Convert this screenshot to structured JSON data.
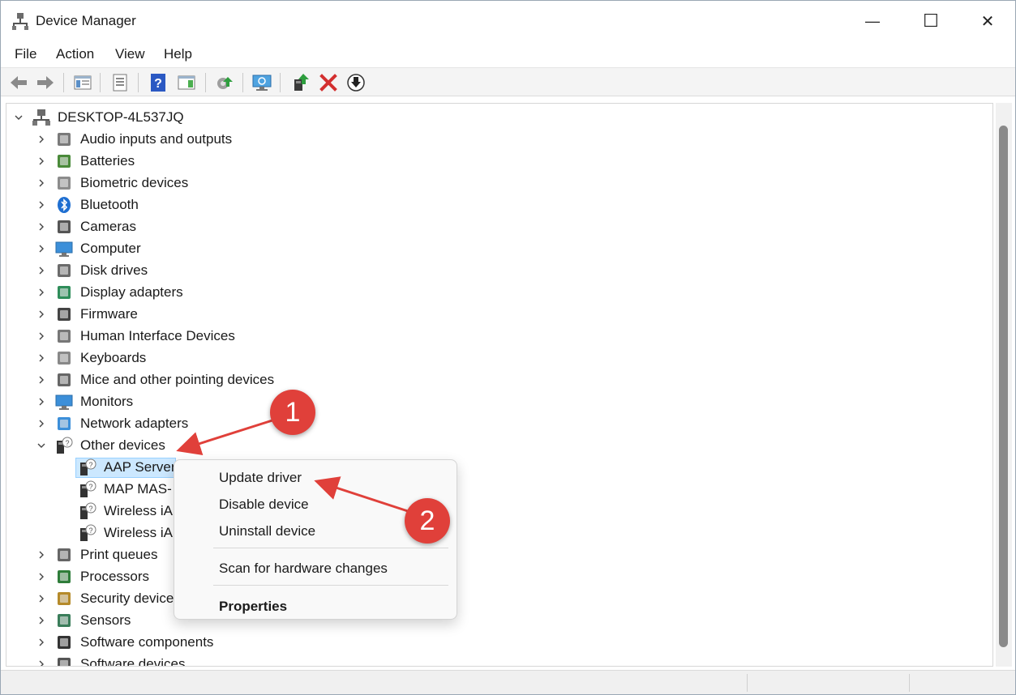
{
  "window": {
    "title": "Device Manager",
    "controls": {
      "minimize": "—",
      "maximize": "☐",
      "close": "✕"
    }
  },
  "menu": [
    "File",
    "Action",
    "View",
    "Help"
  ],
  "toolbar": {
    "icons": [
      "back-icon",
      "forward-icon",
      "show-hide-console-tree-icon",
      "properties-icon",
      "help-icon",
      "action-pane-icon",
      "update-driver-icon",
      "scan-hardware-icon",
      "enable-device-icon",
      "uninstall-device-icon",
      "disable-device-icon"
    ]
  },
  "tree": {
    "root": "DESKTOP-4L537JQ",
    "categories": [
      {
        "label": "Audio inputs and outputs",
        "icon": "speaker-icon"
      },
      {
        "label": "Batteries",
        "icon": "battery-icon"
      },
      {
        "label": "Biometric devices",
        "icon": "fingerprint-icon"
      },
      {
        "label": "Bluetooth",
        "icon": "bluetooth-icon"
      },
      {
        "label": "Cameras",
        "icon": "camera-icon"
      },
      {
        "label": "Computer",
        "icon": "computer-icon"
      },
      {
        "label": "Disk drives",
        "icon": "disk-drive-icon"
      },
      {
        "label": "Display adapters",
        "icon": "display-adapter-icon"
      },
      {
        "label": "Firmware",
        "icon": "firmware-icon"
      },
      {
        "label": "Human Interface Devices",
        "icon": "hid-icon"
      },
      {
        "label": "Keyboards",
        "icon": "keyboard-icon"
      },
      {
        "label": "Mice and other pointing devices",
        "icon": "mouse-icon"
      },
      {
        "label": "Monitors",
        "icon": "monitor-icon"
      },
      {
        "label": "Network adapters",
        "icon": "network-adapter-icon"
      },
      {
        "label": "Other devices",
        "icon": "unknown-device-icon",
        "expanded": true
      }
    ],
    "other_devices_children": [
      "AAP Server",
      "MAP MAS-",
      "Wireless iA",
      "Wireless iA"
    ],
    "categories_after": [
      {
        "label": "Print queues",
        "icon": "printer-icon"
      },
      {
        "label": "Processors",
        "icon": "processor-icon"
      },
      {
        "label": "Security device",
        "icon": "security-device-icon"
      },
      {
        "label": "Sensors",
        "icon": "sensor-icon"
      },
      {
        "label": "Software components",
        "icon": "software-component-icon"
      },
      {
        "label": "Software devices",
        "icon": "software-device-icon"
      }
    ]
  },
  "context_menu": {
    "update_driver": "Update driver",
    "disable_device": "Disable device",
    "uninstall_device": "Uninstall device",
    "scan_hardware": "Scan for hardware changes",
    "properties": "Properties"
  },
  "annotations": {
    "badge_1": "1",
    "badge_2": "2",
    "color": "#e0403a"
  }
}
